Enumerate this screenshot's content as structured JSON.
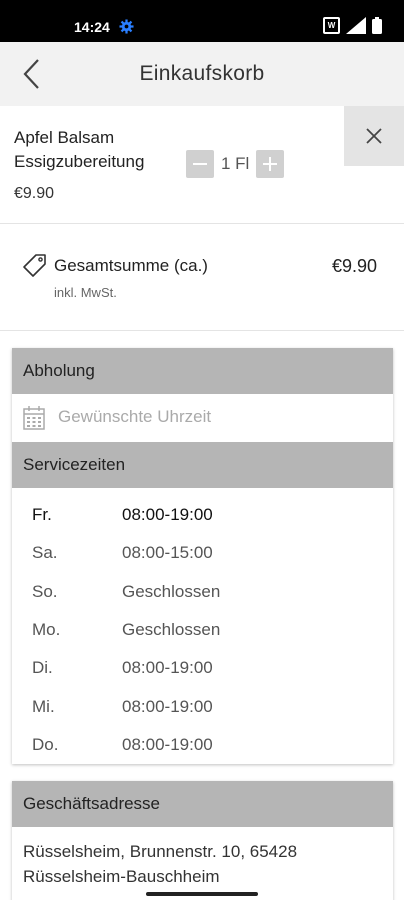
{
  "status_bar": {
    "time": "14:24"
  },
  "header": {
    "title": "Einkaufskorb"
  },
  "cart": {
    "items": [
      {
        "name": "Apfel Balsam Essigzubereitung",
        "quantity": "1 Fl",
        "price": "€9.90"
      }
    ]
  },
  "total": {
    "label": "Gesamtsumme (ca.)",
    "sublabel": "inkl. MwSt.",
    "value": "€9.90"
  },
  "pickup": {
    "title": "Abholung",
    "time_placeholder": "Gewünschte Uhrzeit",
    "service_title": "Servicezeiten",
    "hours": [
      {
        "day": "Fr.",
        "time": "08:00-19:00",
        "active": true
      },
      {
        "day": "Sa.",
        "time": "08:00-15:00",
        "active": false
      },
      {
        "day": "So.",
        "time": "Geschlossen",
        "active": false
      },
      {
        "day": "Mo.",
        "time": "Geschlossen",
        "active": false
      },
      {
        "day": "Di.",
        "time": "08:00-19:00",
        "active": false
      },
      {
        "day": "Mi.",
        "time": "08:00-19:00",
        "active": false
      },
      {
        "day": "Do.",
        "time": "08:00-19:00",
        "active": false
      }
    ]
  },
  "address": {
    "title": "Geschäftsadresse",
    "line1": "Rüsselsheim,  Brunnenstr. 10, 65428",
    "line2": "Rüsselsheim-Bauschheim"
  },
  "colors": {
    "header_bg": "#f2f2f2",
    "section_header_bg": "#b5b5b5",
    "gear_icon": "#2a7fff"
  },
  "icons": [
    "settings-gear-icon",
    "wifi-icon",
    "signal-icon",
    "battery-icon",
    "back-arrow-icon",
    "close-icon",
    "price-tag-icon",
    "calendar-icon",
    "minus-icon",
    "plus-icon"
  ]
}
